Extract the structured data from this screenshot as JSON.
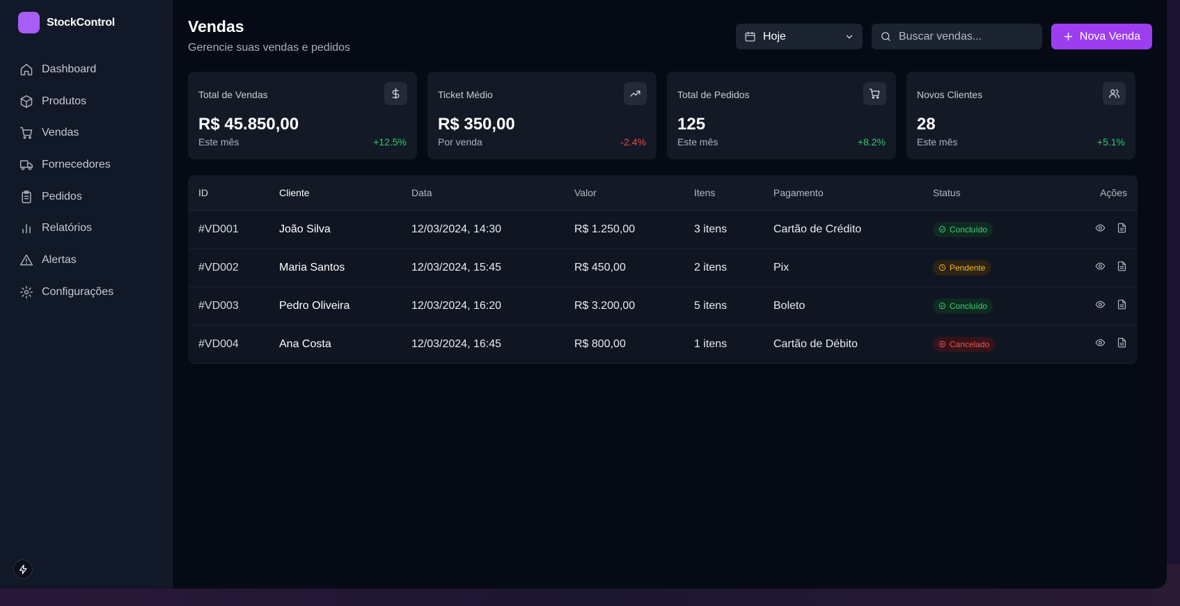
{
  "app": {
    "name": "StockControl"
  },
  "sidebar": {
    "items": [
      {
        "label": "Dashboard",
        "icon": "home-icon"
      },
      {
        "label": "Produtos",
        "icon": "box-icon"
      },
      {
        "label": "Vendas",
        "icon": "cart-icon"
      },
      {
        "label": "Fornecedores",
        "icon": "truck-icon"
      },
      {
        "label": "Pedidos",
        "icon": "clipboard-icon"
      },
      {
        "label": "Relatórios",
        "icon": "bar-chart-icon"
      },
      {
        "label": "Alertas",
        "icon": "warning-icon"
      },
      {
        "label": "Configurações",
        "icon": "gear-icon"
      }
    ]
  },
  "header": {
    "title": "Vendas",
    "subtitle": "Gerencie suas vendas e pedidos",
    "date_filter": "Hoje",
    "search_placeholder": "Buscar vendas...",
    "new_button": "Nova Venda"
  },
  "cards": [
    {
      "label": "Total de Vendas",
      "value": "R$ 45.850,00",
      "sub": "Este mês",
      "delta": "+12.5%",
      "icon": "dollar-icon"
    },
    {
      "label": "Ticket Médio",
      "value": "R$ 350,00",
      "sub": "Por venda",
      "delta": "-2.4%",
      "icon": "trending-up-icon"
    },
    {
      "label": "Total de Pedidos",
      "value": "125",
      "sub": "Este mês",
      "delta": "+8.2%",
      "icon": "cart-icon"
    },
    {
      "label": "Novos Clientes",
      "value": "28",
      "sub": "Este mês",
      "delta": "+5.1%",
      "icon": "users-icon"
    }
  ],
  "table": {
    "columns": [
      "ID",
      "Cliente",
      "Data",
      "Valor",
      "Itens",
      "Pagamento",
      "Status",
      "Ações"
    ],
    "rows": [
      {
        "id": "#VD001",
        "cliente": "João Silva",
        "data": "12/03/2024, 14:30",
        "valor": "R$ 1.250,00",
        "itens": "3 itens",
        "pagamento": "Cartão de Crédito",
        "status": "Concluído"
      },
      {
        "id": "#VD002",
        "cliente": "Maria Santos",
        "data": "12/03/2024, 15:45",
        "valor": "R$ 450,00",
        "itens": "2 itens",
        "pagamento": "Pix",
        "status": "Pendente"
      },
      {
        "id": "#VD003",
        "cliente": "Pedro Oliveira",
        "data": "12/03/2024, 16:20",
        "valor": "R$ 3.200,00",
        "itens": "5 itens",
        "pagamento": "Boleto",
        "status": "Concluído"
      },
      {
        "id": "#VD004",
        "cliente": "Ana Costa",
        "data": "12/03/2024, 16:45",
        "valor": "R$ 800,00",
        "itens": "1 itens",
        "pagamento": "Cartão de Débito",
        "status": "Cancelado"
      }
    ]
  },
  "colors": {
    "accent": "#9c3ef0",
    "positive": "#34c86b",
    "negative": "#ef4545",
    "pending": "#f2b735"
  }
}
